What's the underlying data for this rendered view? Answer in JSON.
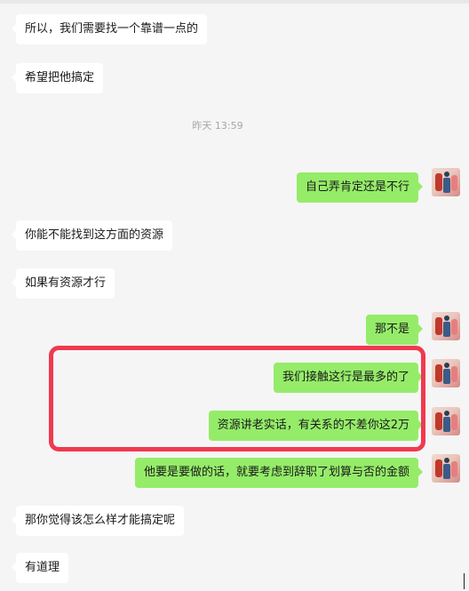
{
  "chat": {
    "messages": [
      {
        "text": "所以，我们需要找一个靠谱一点的"
      },
      {
        "text": "希望把他搞定"
      },
      {
        "text": "自己弄肯定还是不行"
      },
      {
        "text": "你能不能找到这方面的资源"
      },
      {
        "text": "如果有资源才行"
      },
      {
        "text": "那不是"
      },
      {
        "text": "我们接触这行是最多的了"
      },
      {
        "text": "资源讲老实话，有关系的不差你这2万"
      },
      {
        "text": "他要是要做的话，就要考虑到辞职了划算与否的金额"
      },
      {
        "text": "那你觉得该怎么样才能搞定呢"
      },
      {
        "text": "有道理"
      }
    ],
    "timestamp": "昨天 13:59"
  },
  "annotation": {
    "color": "#f0394f"
  },
  "colors": {
    "outgoing_bubble": "#95ec69",
    "incoming_bubble": "#ffffff",
    "background": "#f5f5f5"
  },
  "icons": {
    "avatar": "user-avatar-image"
  }
}
